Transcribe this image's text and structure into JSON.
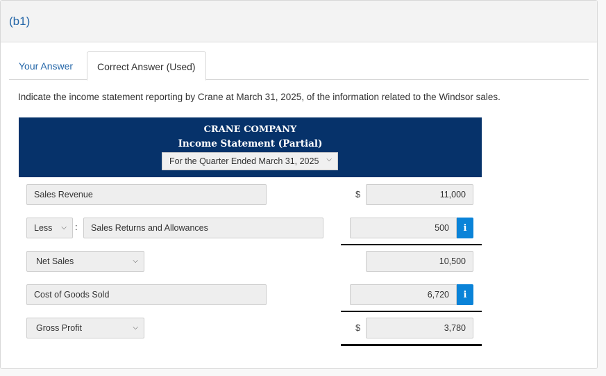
{
  "part_label": "(b1)",
  "tabs": [
    {
      "label": "Your Answer",
      "active": false
    },
    {
      "label": "Correct Answer (Used)",
      "active": true
    }
  ],
  "question": "Indicate the income statement reporting by Crane at March 31, 2025, of the information related to the Windsor sales.",
  "statement": {
    "company": "CRANE COMPANY",
    "title": "Income Statement (Partial)",
    "period": "For the Quarter Ended March 31, 2025"
  },
  "rows": [
    {
      "label": "Sales Revenue",
      "currency": "$",
      "amount": "11,000"
    },
    {
      "prefix": "Less",
      "separator": ":",
      "label": "Sales Returns and Allowances",
      "amount": "500",
      "info": "i"
    },
    {
      "label": "Net Sales",
      "amount": "10,500"
    },
    {
      "label": "Cost of Goods Sold",
      "amount": "6,720",
      "info": "i"
    },
    {
      "label": "Gross Profit",
      "currency": "$",
      "amount": "3,780"
    }
  ],
  "icons": {
    "chevron": "⌄"
  },
  "colors": {
    "header_bg": "#06326a",
    "info_blue": "#0a83d8",
    "link_blue": "#2466a8"
  }
}
